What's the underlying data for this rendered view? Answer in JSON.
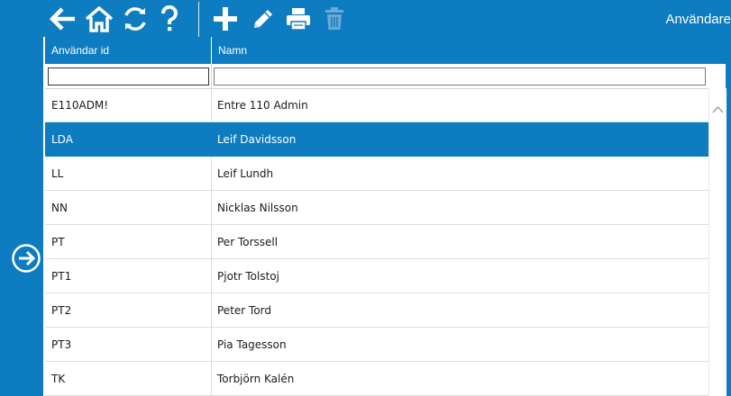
{
  "app": {
    "title": "Användare"
  },
  "toolbar": {
    "icons": [
      "back-arrow-icon",
      "home-icon",
      "refresh-icon",
      "help-icon",
      "add-icon",
      "edit-pencil-icon",
      "print-icon",
      "delete-trash-icon"
    ]
  },
  "side": {
    "icon": "arrow-right-circle-icon"
  },
  "grid": {
    "columns": [
      "Användar id",
      "Namn"
    ],
    "filters": {
      "id_value": "",
      "name_value": ""
    },
    "rows": [
      {
        "id": "E110ADM!",
        "name": "Entre 110 Admin",
        "selected": false
      },
      {
        "id": "LDA",
        "name": "Leif Davidsson",
        "selected": true
      },
      {
        "id": "LL",
        "name": "Leif Lundh",
        "selected": false
      },
      {
        "id": "NN",
        "name": "Nicklas Nilsson",
        "selected": false
      },
      {
        "id": "PT",
        "name": "Per Torssell",
        "selected": false
      },
      {
        "id": "PT1",
        "name": "Pjotr Tolstoj",
        "selected": false
      },
      {
        "id": "PT2",
        "name": "Peter Tord",
        "selected": false
      },
      {
        "id": "PT3",
        "name": "Pia Tagesson",
        "selected": false
      },
      {
        "id": "TK",
        "name": "Torbjörn Kalén",
        "selected": false
      }
    ]
  },
  "colors": {
    "accent": "#0e7cc0",
    "disabled_icon": "#6aa9d6"
  }
}
